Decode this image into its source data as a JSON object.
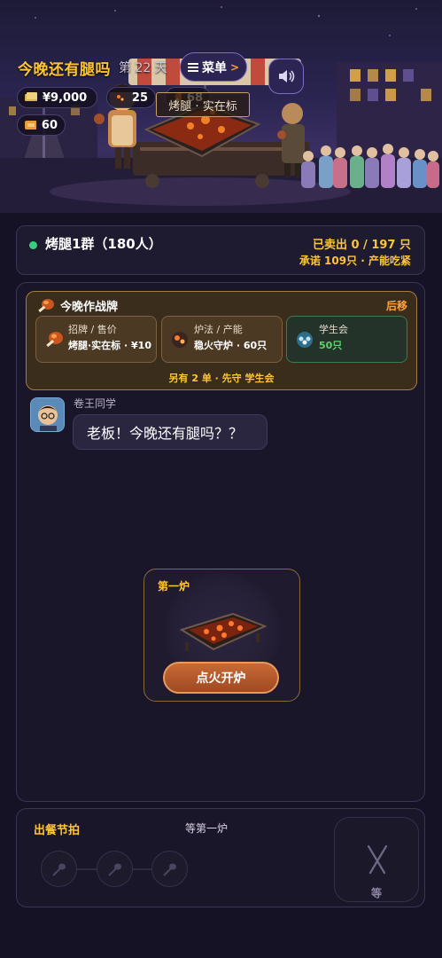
{
  "header": {
    "title": "今晚还有腿吗",
    "day": "第 22 天",
    "menu_label": "菜单",
    "menu_arrow": ">",
    "sound_icon": "speaker-icon"
  },
  "resources": {
    "money": "¥9,000",
    "charcoal": "25",
    "legs": "68",
    "tickets": "60"
  },
  "stall": {
    "sign": "烤腿 · 实在标"
  },
  "group": {
    "status_color": "#35d07f",
    "name": "烤腿1群（180人）",
    "sold": "已卖出 0 / 197 只",
    "promise": "承诺 109只 · 产能吃紧"
  },
  "strategy": {
    "title": "今晚作战牌",
    "later_label": "后移",
    "cards": [
      {
        "label": "招牌 / 售价",
        "value": "烤腿·实在标 · ¥10",
        "icon": "drumstick-icon"
      },
      {
        "label": "炉法 / 产能",
        "value": "稳火守炉 · 60只",
        "icon": "charcoal-icon"
      },
      {
        "label": "学生会",
        "value": "50只",
        "icon": "student-council-icon"
      }
    ],
    "footer": "另有 2 单 · 先守 学生会"
  },
  "message": {
    "sender": "卷王同学",
    "text": "老板！今晚还有腿吗？？"
  },
  "furnace": {
    "title": "第一炉",
    "button_label": "点火开炉"
  },
  "rhythm": {
    "title": "出餐节拍",
    "status": "等第一炉",
    "slots": [
      "drumstick-slot-icon",
      "drumstick-slot-icon",
      "drumstick-slot-icon"
    ],
    "wait_label": "等",
    "wait_icon": "crossed-skewers-icon"
  },
  "colors": {
    "accent": "#ffc533",
    "button": "#c86a35",
    "success": "#35d07f",
    "panel": "#1a1629"
  }
}
